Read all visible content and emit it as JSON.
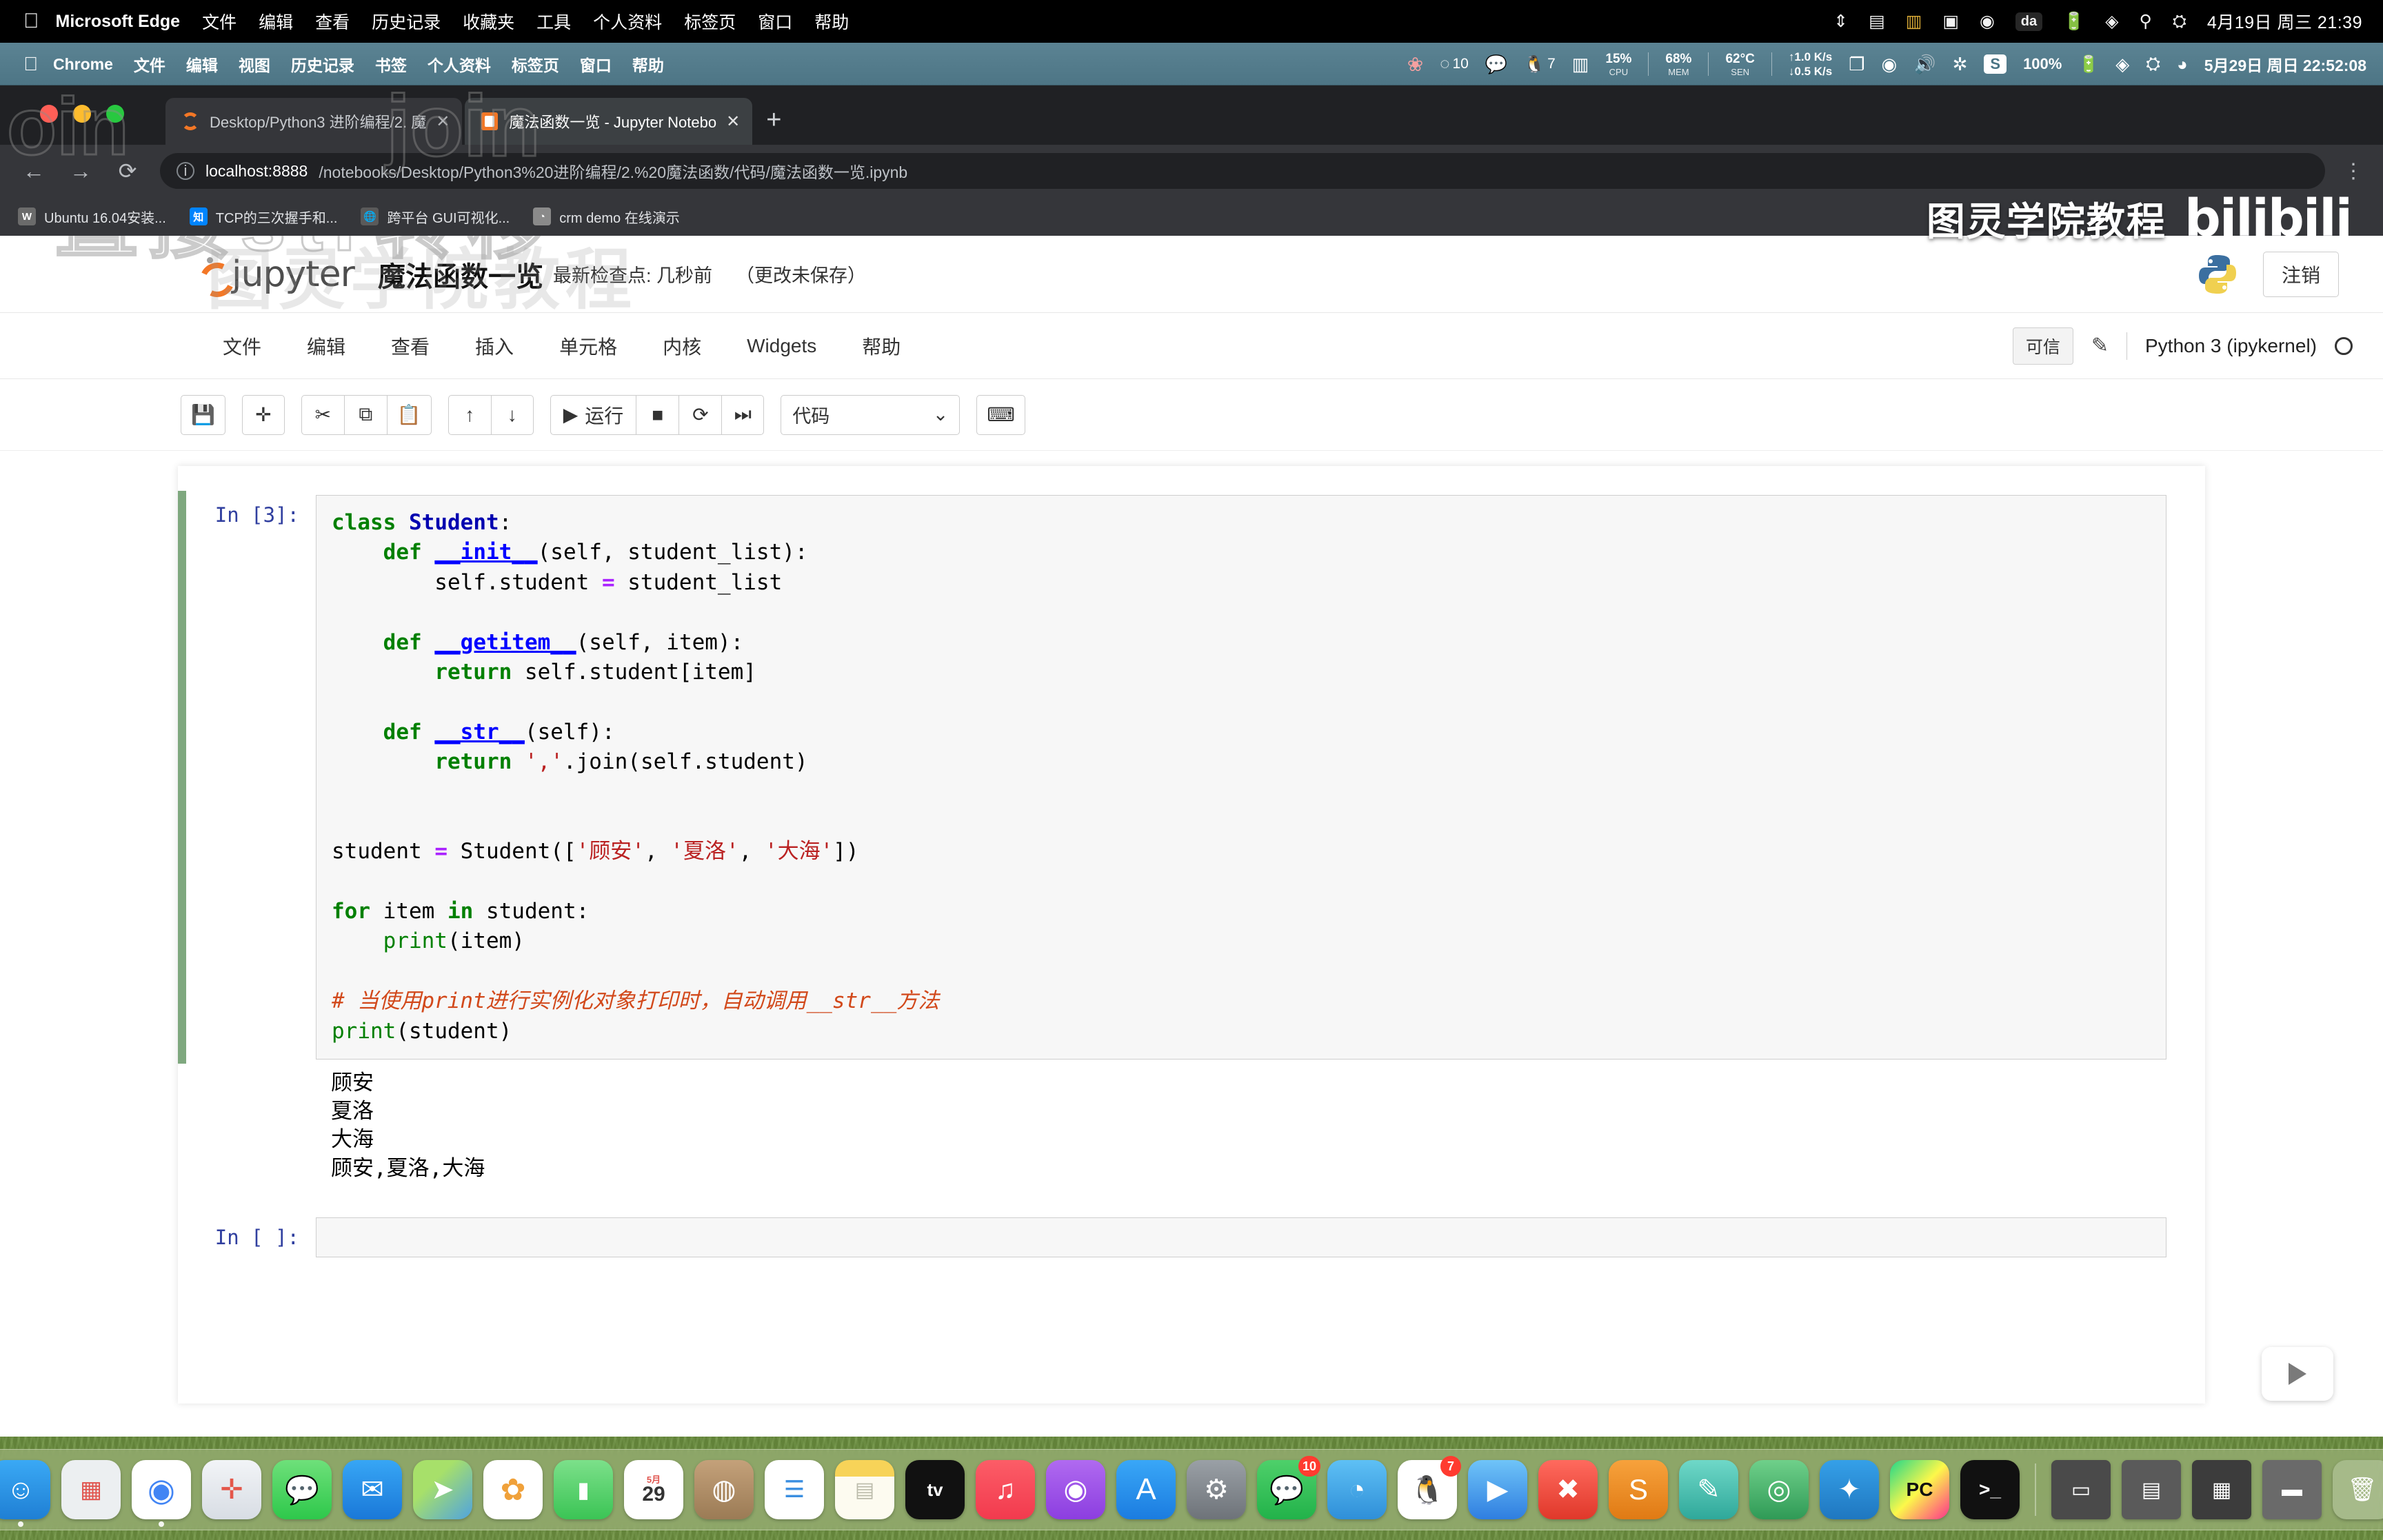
{
  "host_menubar": {
    "apple": "",
    "app": "Microsoft Edge",
    "items": [
      "文件",
      "编辑",
      "查看",
      "历史记录",
      "收藏夹",
      "工具",
      "个人资料",
      "标签页",
      "窗口",
      "帮助"
    ],
    "right_icons": [
      "upload-icon",
      "display-icon",
      "grid-icon",
      "tv-icon",
      "play-icon",
      "da-icon",
      "battery-icon",
      "wifi-icon",
      "search-icon",
      "control-center-icon"
    ],
    "da_label": "da",
    "clock": "4月19日 周三  21:39"
  },
  "vm_menubar": {
    "app": "Chrome",
    "items": [
      "文件",
      "编辑",
      "视图",
      "历史记录",
      "书签",
      "个人资料",
      "标签页",
      "窗口",
      "帮助"
    ],
    "qq_badge": "10",
    "qq2_badge": "7",
    "cpu": {
      "value": "15%",
      "label": "CPU"
    },
    "mem": {
      "value": "68%",
      "label": "MEM"
    },
    "sen": {
      "value": "62°C",
      "label": "SEN"
    },
    "net_up": "1.0 K/s",
    "net_down": "0.5 K/s",
    "sogou": "S",
    "battery": "100%",
    "clock": "5月29日 周日 22:52:08"
  },
  "browser": {
    "tabs": [
      {
        "title": "Desktop/Python3 进阶编程/2. 魔",
        "favicon": "jupyter-ring-icon",
        "active": false,
        "close": "✕"
      },
      {
        "title": "魔法函数一览 - Jupyter Notebo",
        "favicon": "jupyter-book-icon",
        "active": true,
        "close": "✕"
      }
    ],
    "new_tab": "+",
    "nav": {
      "back": "←",
      "forward": "→",
      "reload": "⟳",
      "menu": "⋮"
    },
    "url_host": "localhost:8888",
    "url_path": "/notebooks/Desktop/Python3%20进阶编程/2.%20魔法函数/代码/魔法函数一览.ipynb",
    "bookmarks": [
      {
        "label": "Ubuntu 16.04安装...",
        "icon_text": "W",
        "icon_color": "#6b6b6b"
      },
      {
        "label": "TCP的三次握手和...",
        "icon_text": "知",
        "icon_color": "#0084ff"
      },
      {
        "label": "跨平台 GUI可视化...",
        "icon_text": "🌐",
        "icon_color": "#5a5a5a"
      },
      {
        "label": "crm demo 在线演示",
        "icon_text": "◔",
        "icon_color": "#8a8a8a"
      }
    ]
  },
  "watermarks": {
    "join_left": "oin",
    "join_mid": "join",
    "cn_big": "直接str转移",
    "cn_faint": "图灵学院教程"
  },
  "brand": {
    "cn": "图灵学院教程",
    "bili": "bilibili"
  },
  "jupyter": {
    "logo_word": "jupyter",
    "notebook_name": "魔法函数一览",
    "checkpoint": "最新检查点: 几秒前",
    "unsaved": "（更改未保存）",
    "logout": "注销",
    "python_logo": "python-logo-icon",
    "menu": [
      "文件",
      "编辑",
      "查看",
      "插入",
      "单元格",
      "内核",
      "Widgets",
      "帮助"
    ],
    "trusted": "可信",
    "edit_pencil": "pencil-icon",
    "kernel": "Python 3 (ipykernel)",
    "kernel_status": "idle-circle-icon",
    "toolbar": {
      "save": "💾",
      "add": "✛",
      "cut": "✂",
      "copy": "⧉",
      "paste": "📋",
      "move_up": "↑",
      "move_down": "↓",
      "run_icon": "▶",
      "run_label": "运行",
      "stop": "■",
      "restart": "⟳",
      "restart_run_all": "⏭",
      "cell_type": "代码",
      "cell_type_caret": "⌄",
      "command_palette": "⌨"
    }
  },
  "notebook": {
    "cells": [
      {
        "prompt": "In [3]:",
        "selected": true,
        "source_lines": [
          "class Student:",
          "    def __init__(self, student_list):",
          "        self.student = student_list",
          "",
          "    def __getitem__(self, item):",
          "        return self.student[item]",
          "",
          "    def __str__(self):",
          "        return ','.join(self.student)",
          "",
          "",
          "student = Student(['顾安', '夏洛', '大海'])",
          "",
          "for item in student:",
          "    print(item)",
          "",
          "# 当使用print进行实例化对象打印时，自动调用__str__方法",
          "print(student)"
        ],
        "output_lines": [
          "顾安",
          "夏洛",
          "大海",
          "顾安,夏洛,大海"
        ]
      },
      {
        "prompt": "In [ ]:",
        "selected": false,
        "source_lines": [
          ""
        ],
        "output_lines": []
      }
    ]
  },
  "dock": {
    "items": [
      {
        "name": "finder",
        "glyph": "☺",
        "bg": "linear-gradient(180deg,#3aa9f5,#1f7fd4)",
        "running": true
      },
      {
        "name": "launchpad",
        "glyph": "▦",
        "bg": "#eceff1",
        "running": false
      },
      {
        "name": "chrome",
        "glyph": "◉",
        "bg": "#fff",
        "running": true
      },
      {
        "name": "safari",
        "glyph": "🧭",
        "bg": "linear-gradient(180deg,#f2f4f7,#d8dde4)",
        "running": false
      },
      {
        "name": "messages",
        "glyph": "💬",
        "bg": "linear-gradient(180deg,#6ee07a,#2ec84b)",
        "running": false
      },
      {
        "name": "mail",
        "glyph": "✉",
        "bg": "linear-gradient(180deg,#37a6f5,#1a78d8)",
        "running": false
      },
      {
        "name": "maps",
        "glyph": "➤",
        "bg": "linear-gradient(135deg,#a7e06a,#4fa3e0)",
        "running": false
      },
      {
        "name": "photos",
        "glyph": "✿",
        "bg": "#fff",
        "running": false
      },
      {
        "name": "facetime",
        "glyph": "🎥",
        "bg": "linear-gradient(180deg,#7ce08a,#3bc455)",
        "running": false
      },
      {
        "name": "calendar",
        "glyph": "29",
        "bg": "#fff",
        "running": false,
        "sub": "5月"
      },
      {
        "name": "contacts",
        "glyph": "◍",
        "bg": "linear-gradient(180deg,#c4a17a,#9b7b55)",
        "running": false
      },
      {
        "name": "reminders",
        "glyph": "☰",
        "bg": "#fff",
        "running": false
      },
      {
        "name": "notes",
        "glyph": "▤",
        "bg": "linear-gradient(180deg,#f7d358,#fdfbf0)",
        "running": false
      },
      {
        "name": "apple-tv",
        "glyph": "tv",
        "bg": "#111",
        "running": false
      },
      {
        "name": "music",
        "glyph": "♫",
        "bg": "linear-gradient(180deg,#fc5d67,#f23a4e)",
        "running": false
      },
      {
        "name": "podcasts",
        "glyph": "◉",
        "bg": "linear-gradient(180deg,#b06af0,#8c3ee0)",
        "running": false
      },
      {
        "name": "app-store",
        "glyph": "A",
        "bg": "linear-gradient(180deg,#39a7f7,#1b7ce0)",
        "running": false
      },
      {
        "name": "system-preferences",
        "glyph": "⚙",
        "bg": "linear-gradient(180deg,#9aa0a6,#6e7379)",
        "running": false
      },
      {
        "name": "wechat",
        "glyph": "💬",
        "bg": "linear-gradient(180deg,#4ed06a,#22b24a)",
        "running": false,
        "badge": "10"
      },
      {
        "name": "tencent-meeting",
        "glyph": "◔",
        "bg": "linear-gradient(180deg,#5ec0f5,#2f8fd8)",
        "running": false
      },
      {
        "name": "qq",
        "glyph": "🐧",
        "bg": "#fff",
        "running": false,
        "badge": "7"
      },
      {
        "name": "video-player",
        "glyph": "▶",
        "bg": "linear-gradient(180deg,#6fc4f8,#2f7ee0)",
        "running": false
      },
      {
        "name": "xmind",
        "glyph": "✖",
        "bg": "linear-gradient(180deg,#ff6a5e,#e0382a)",
        "running": false
      },
      {
        "name": "sublime-text",
        "glyph": "S",
        "bg": "linear-gradient(180deg,#f7a23c,#e07a14)",
        "running": false
      },
      {
        "name": "editor",
        "glyph": "✎",
        "bg": "linear-gradient(180deg,#6fd8c8,#2fa89a)",
        "running": false
      },
      {
        "name": "anaconda",
        "glyph": "◎",
        "bg": "linear-gradient(180deg,#6fd08a,#2f9a56)",
        "running": false
      },
      {
        "name": "vscode",
        "glyph": "✦",
        "bg": "linear-gradient(180deg,#35a0e8,#1f77c0)",
        "running": false
      },
      {
        "name": "pycharm",
        "glyph": "PC",
        "bg": "linear-gradient(135deg,#21d789,#fcf84a,#ff318c)",
        "running": false
      },
      {
        "name": "terminal",
        "glyph": ">_",
        "bg": "#111",
        "running": false
      }
    ],
    "trash_items": [
      {
        "name": "screenshot-1",
        "glyph": "▭"
      },
      {
        "name": "screenshot-2",
        "glyph": "▤"
      },
      {
        "name": "document",
        "glyph": "▦"
      },
      {
        "name": "folder",
        "glyph": "▬"
      },
      {
        "name": "trash",
        "glyph": "🗑"
      }
    ]
  }
}
